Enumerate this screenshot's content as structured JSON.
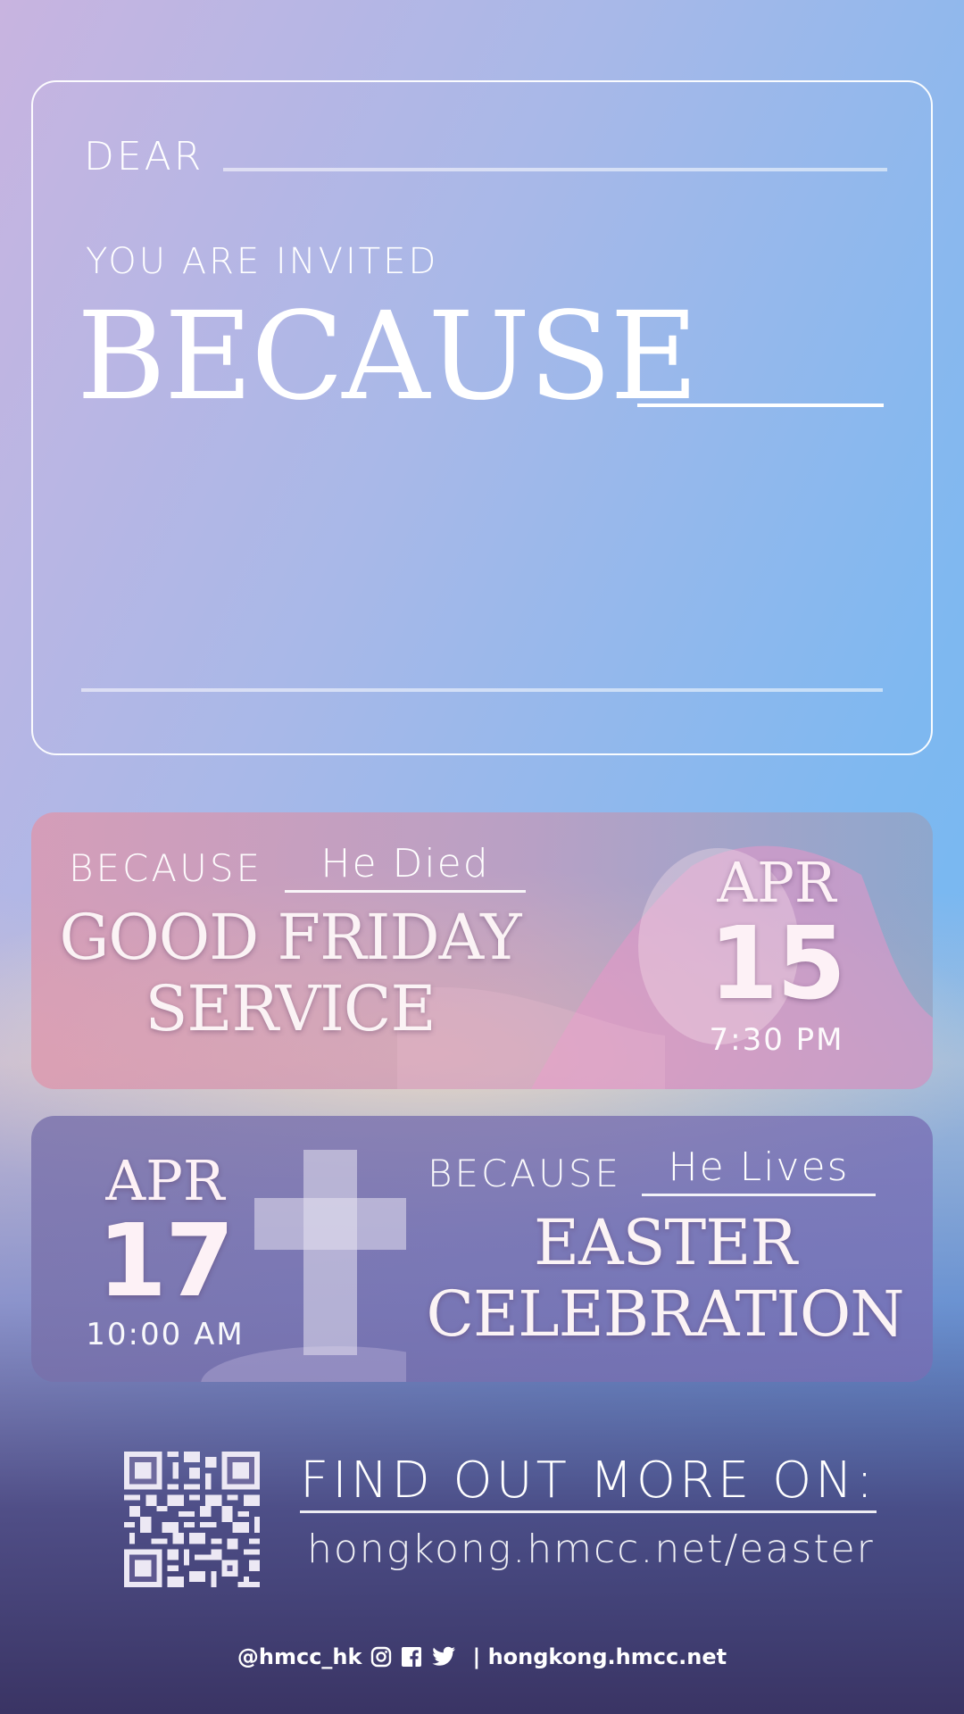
{
  "invitation": {
    "dear_label": "DEAR",
    "invited_label": "YOU ARE INVITED",
    "because_label": "BECAUSE"
  },
  "events": [
    {
      "because_label": "BECAUSE",
      "reason": "He Died",
      "title_line1": "GOOD FRIDAY",
      "title_line2": "SERVICE",
      "month": "APR",
      "day": "15",
      "time": "7:30 PM"
    },
    {
      "because_label": "BECAUSE",
      "reason": "He Lives",
      "title_line1": "EASTER",
      "title_line2": "CELEBRATION",
      "month": "APR",
      "day": "17",
      "time": "10:00 AM"
    }
  ],
  "more_info": {
    "heading": "FIND OUT MORE ON:",
    "url": "hongkong.hmcc.net/easter",
    "qr_icon": "qr-code"
  },
  "footer": {
    "handle": "@hmcc_hk",
    "social_icons": [
      "instagram-icon",
      "facebook-icon",
      "twitter-icon"
    ],
    "website": "| hongkong.hmcc.net"
  },
  "colors": {
    "sky_top": "#6ab6f4",
    "sky_left": "#c8b4e0",
    "friday_card": "#de96ac",
    "easter_card": "#7870aa",
    "bottom": "#3a3464"
  }
}
